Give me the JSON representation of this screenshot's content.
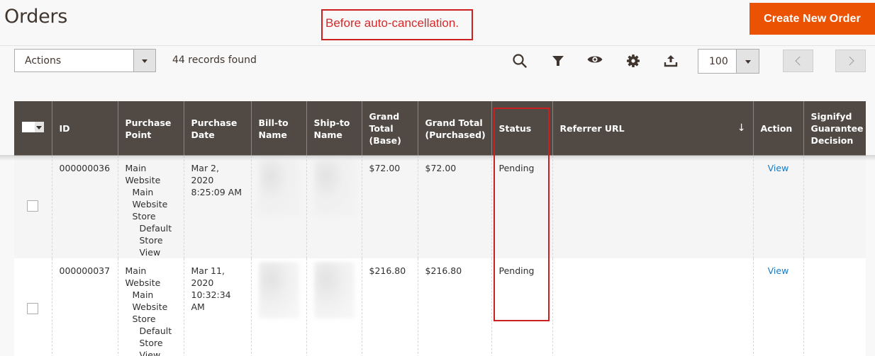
{
  "page": {
    "title": "Orders",
    "annotation": "Before auto-cancellation.",
    "create_button": "Create New Order"
  },
  "toolbar": {
    "actions_label": "Actions",
    "records_found": "44 records found",
    "icons": [
      "search-icon",
      "filter-icon",
      "eye-icon",
      "gear-icon",
      "export-icon"
    ],
    "per_page": "100",
    "prev_label": "<",
    "next_label": ">"
  },
  "grid": {
    "columns": [
      "",
      "ID",
      "Purchase Point",
      "Purchase Date",
      "Bill-to Name",
      "Ship-to Name",
      "Grand Total (Base)",
      "Grand Total (Purchased)",
      "Status",
      "Referrer URL",
      "Action",
      "Signifyd Guarantee Decision"
    ],
    "sort_indicator": "↓",
    "rows": [
      {
        "id": "000000036",
        "purchase_point": [
          "Main Website",
          "Main Website Store",
          "Default Store View"
        ],
        "purchase_date": "Mar 2, 2020 8:25:09 AM",
        "bill_to": "",
        "ship_to": "",
        "grand_total_base": "$72.00",
        "grand_total_purchased": "$72.00",
        "status": "Pending",
        "referrer_url": "",
        "action": "View",
        "signifyd": ""
      },
      {
        "id": "000000037",
        "purchase_point": [
          "Main Website",
          "Main Website Store",
          "Default Store View"
        ],
        "purchase_date": "Mar 11, 2020 10:32:34 AM",
        "bill_to": "",
        "ship_to": "",
        "grand_total_base": "$216.80",
        "grand_total_purchased": "$216.80",
        "status": "Pending",
        "referrer_url": "",
        "action": "View",
        "signifyd": ""
      }
    ]
  },
  "colors": {
    "accent": "#eb5202",
    "header_bg": "#514943",
    "link": "#1979c3",
    "annotation": "#cc1f1f"
  }
}
